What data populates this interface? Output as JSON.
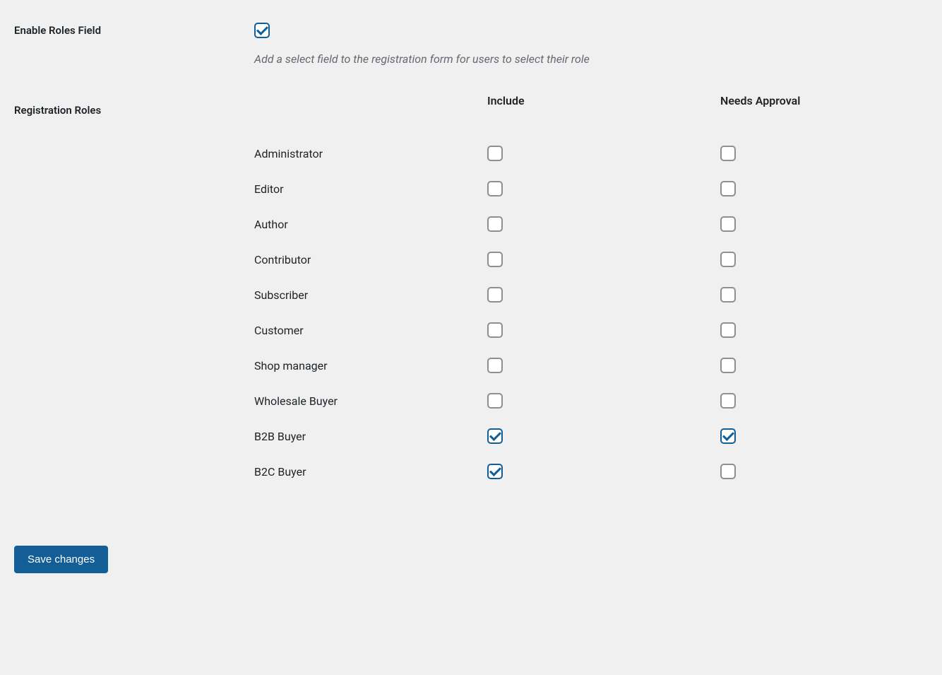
{
  "fields": {
    "enable_roles": {
      "label": "Enable Roles Field",
      "checked": true,
      "description": "Add a select field to the registration form for users to select their role"
    },
    "registration_roles": {
      "label": "Registration Roles",
      "columns": {
        "name": "",
        "include": "Include",
        "approval": "Needs Approval"
      },
      "rows": [
        {
          "name": "Administrator",
          "include": false,
          "approval": false
        },
        {
          "name": "Editor",
          "include": false,
          "approval": false
        },
        {
          "name": "Author",
          "include": false,
          "approval": false
        },
        {
          "name": "Contributor",
          "include": false,
          "approval": false
        },
        {
          "name": "Subscriber",
          "include": false,
          "approval": false
        },
        {
          "name": "Customer",
          "include": false,
          "approval": false
        },
        {
          "name": "Shop manager",
          "include": false,
          "approval": false
        },
        {
          "name": "Wholesale Buyer",
          "include": false,
          "approval": false
        },
        {
          "name": "B2B Buyer",
          "include": true,
          "approval": true
        },
        {
          "name": "B2C Buyer",
          "include": true,
          "approval": false
        }
      ]
    }
  },
  "buttons": {
    "save": "Save changes"
  }
}
